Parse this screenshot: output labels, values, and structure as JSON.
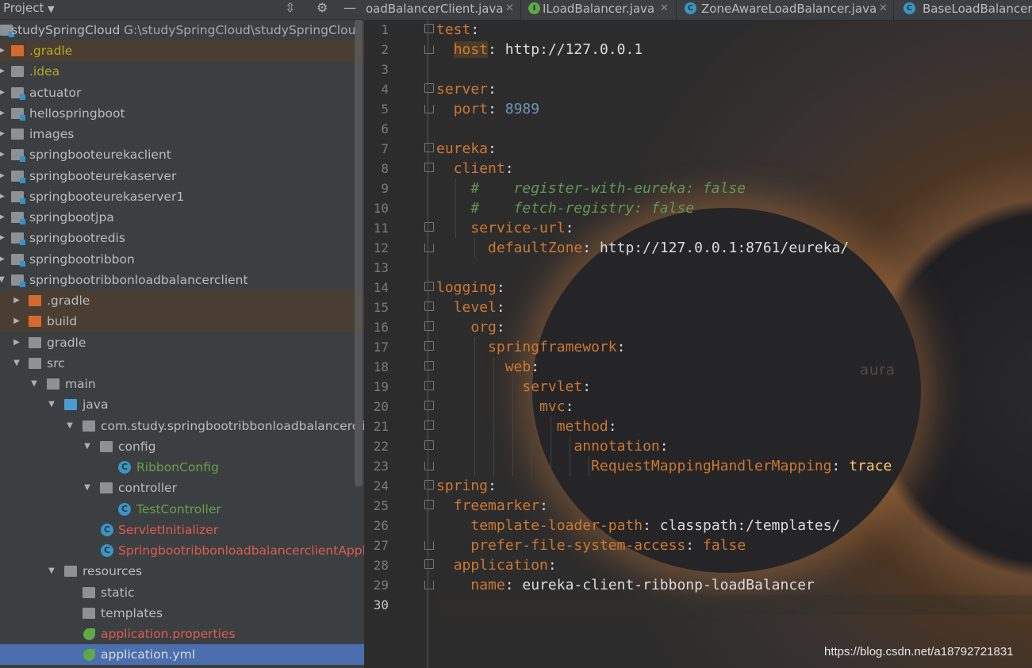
{
  "project_panel": {
    "title": "Project",
    "root": {
      "name": "studySpringCloud",
      "path": "G:\\studySpringCloud\\studySpringCloud"
    },
    "items": [
      {
        "label": ".gradle"
      },
      {
        "label": ".idea"
      },
      {
        "label": "actuator"
      },
      {
        "label": "hellospringboot"
      },
      {
        "label": "images"
      },
      {
        "label": "springbooteurekaclient"
      },
      {
        "label": "springbooteurekaserver"
      },
      {
        "label": "springbooteurekaserver1"
      },
      {
        "label": "springbootjpa"
      },
      {
        "label": "springbootredis"
      },
      {
        "label": "springbootribbon"
      },
      {
        "label": "springbootribbonloadbalancerclient"
      },
      {
        "label": ".gradle"
      },
      {
        "label": "build"
      },
      {
        "label": "gradle"
      },
      {
        "label": "src"
      },
      {
        "label": "main"
      },
      {
        "label": "java"
      },
      {
        "label": "com.study.springbootribbonloadbalancerclient"
      },
      {
        "label": "config"
      },
      {
        "label": "RibbonConfig"
      },
      {
        "label": "controller"
      },
      {
        "label": "TestController"
      },
      {
        "label": "ServletInitializer"
      },
      {
        "label": "SpringbootribbonloadbalancerclientApplication"
      },
      {
        "label": "resources"
      },
      {
        "label": "static"
      },
      {
        "label": "templates"
      },
      {
        "label": "application.properties"
      },
      {
        "label": "application.yml"
      }
    ]
  },
  "tabs": [
    {
      "label": "oadBalancerClient.java"
    },
    {
      "label": "ILoadBalancer.java"
    },
    {
      "label": "ZoneAwareLoadBalancer.java"
    },
    {
      "label": "BaseLoadBalancer.java"
    }
  ],
  "editor": {
    "line_numbers": [
      "1",
      "2",
      "3",
      "4",
      "5",
      "6",
      "7",
      "8",
      "9",
      "10",
      "11",
      "12",
      "13",
      "14",
      "15",
      "16",
      "17",
      "18",
      "19",
      "20",
      "21",
      "22",
      "23",
      "24",
      "25",
      "26",
      "27",
      "28",
      "29",
      "30"
    ],
    "lines": {
      "l1_key": "test",
      "l2_key": "host",
      "l2_val": "http://127.0.0.1",
      "l4_key": "server",
      "l5_key": "port",
      "l5_val": "8989",
      "l7_key": "eureka",
      "l8_key": "client",
      "l9_comment": "#    register-with-eureka: false",
      "l10_comment": "#    fetch-registry: false",
      "l11_key": "service-url",
      "l12_key": "defaultZone",
      "l12_val": "http://127.0.0.1:8761/eureka/",
      "l14_key": "logging",
      "l15_key": "level",
      "l16_key": "org",
      "l17_key": "springframework",
      "l18_key": "web",
      "l19_key": "servlet",
      "l20_key": "mvc",
      "l21_key": "method",
      "l22_key": "annotation",
      "l23_key": "RequestMappingHandlerMapping",
      "l23_val": "trace",
      "l24_key": "spring",
      "l25_key": "freemarker",
      "l26_key": "template-loader-path",
      "l26_val": "classpath:/templates/",
      "l27_key": "prefer-file-system-access",
      "l27_val": "false",
      "l28_key": "application",
      "l29_key": "name",
      "l29_val": "eureka-client-ribbonp-loadBalancer"
    },
    "background_text": "aura",
    "watermark": "https://blog.csdn.net/a18792721831"
  },
  "colors": {
    "yaml_key": "#cc7832",
    "number": "#6897bb",
    "comment": "#629755",
    "selection": "#4b6eaf"
  }
}
